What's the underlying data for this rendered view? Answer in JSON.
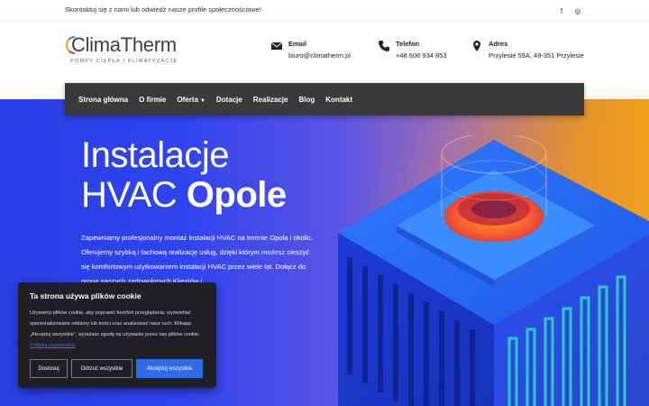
{
  "topbar": {
    "message": "Skontaktuj się z nami lub odwiedź nasze profile społecznościowe!",
    "social": [
      {
        "icon": "facebook-icon",
        "glyph": "f"
      },
      {
        "icon": "instagram-icon",
        "glyph": "◎"
      }
    ]
  },
  "header": {
    "logo": {
      "name": "ClimaTherm",
      "tagline": "POMPY CIEPŁA I KLIMATYZACJE"
    },
    "contacts": [
      {
        "icon": "email-icon",
        "label": "Email",
        "value": "biuro@climatherm.pl"
      },
      {
        "icon": "phone-icon",
        "label": "Telefon",
        "value": "+48 606 934 853"
      },
      {
        "icon": "location-pin-icon",
        "label": "Adres",
        "value": "Przylesie 59A, 49-351 Przylesie"
      }
    ]
  },
  "nav": {
    "items": [
      {
        "label": "Strona główna"
      },
      {
        "label": "O firmie"
      },
      {
        "label": "Oferta",
        "has_dropdown": true
      },
      {
        "label": "Dotacje"
      },
      {
        "label": "Realizacje"
      },
      {
        "label": "Blog"
      },
      {
        "label": "Kontakt"
      }
    ]
  },
  "hero": {
    "title_line1": "Instalacje",
    "title_line2_light": "HVAC ",
    "title_line2_bold": "Opole",
    "paragraph": "Zapewniamy profesjonalny montaż instalacji HVAC na terenie Opola i okolic. Oferujemy szybką i fachową realizację usług, dzięki którym możesz cieszyć się komfortowym użytkowaniem instalacji HVAC przez wiele lat. Dołącz do grona naszych zadowolonych Klientów i"
  },
  "cookie": {
    "title": "Ta strona używa plików cookie",
    "text": "Używamy plików cookie, aby poprawić komfort przeglądania, wyświetlać spersonalizowane reklamy lub treści oraz analizować nasz ruch. Klikając „Akceptuj wszystkie”, wyrażasz zgodę na używanie przez nas plików cookie.",
    "link": "Polityka prywatności",
    "buttons": {
      "customize": "Dostosuj",
      "reject": "Odrzuć wszystkie",
      "accept": "Akceptuj wszystkie"
    }
  },
  "colors": {
    "accent_blue": "#2f6be8",
    "nav_bg": "#3a3a3a",
    "hero_blue": "#2f44ef",
    "hero_orange": "#efa11c"
  }
}
